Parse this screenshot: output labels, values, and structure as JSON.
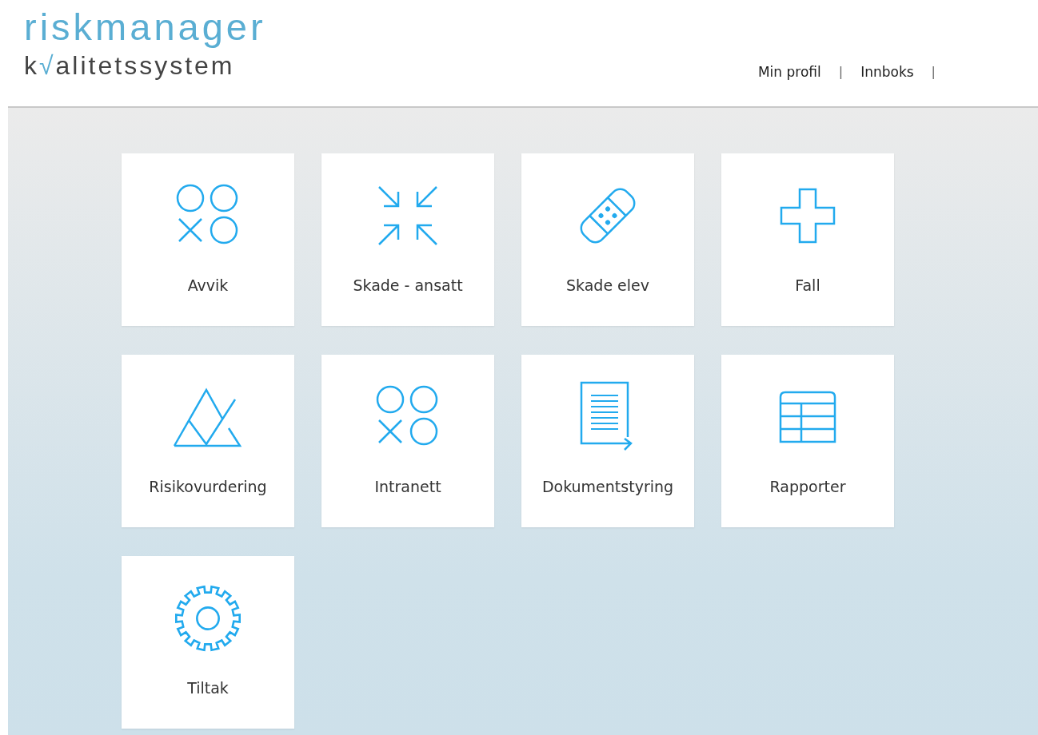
{
  "logo": {
    "title": "riskmanager",
    "subtitle_parts": [
      {
        "text": "k",
        "accent": false
      },
      {
        "text": "√",
        "accent": true
      },
      {
        "text": "alitetssystem",
        "accent": false
      }
    ]
  },
  "nav": [
    {
      "kind": "link",
      "label": "Min profil"
    },
    {
      "kind": "separator",
      "label": "|"
    },
    {
      "kind": "link",
      "label": "Innboks"
    },
    {
      "kind": "separator",
      "label": "|"
    }
  ],
  "tiles": [
    {
      "label": "Avvik",
      "kind": "shapes"
    },
    {
      "label": "Skade - ansatt",
      "kind": "arrows"
    },
    {
      "label": "Skade elev",
      "kind": "bandage"
    },
    {
      "label": "Fall",
      "kind": "cross"
    },
    {
      "label": "Risikovurdering",
      "kind": "mountain"
    },
    {
      "label": "Intranett",
      "kind": "shapes"
    },
    {
      "label": "Dokumentstyring",
      "kind": "document"
    },
    {
      "label": "Rapporter",
      "kind": "table"
    },
    {
      "label": "Tiltak",
      "kind": "gear"
    }
  ]
}
